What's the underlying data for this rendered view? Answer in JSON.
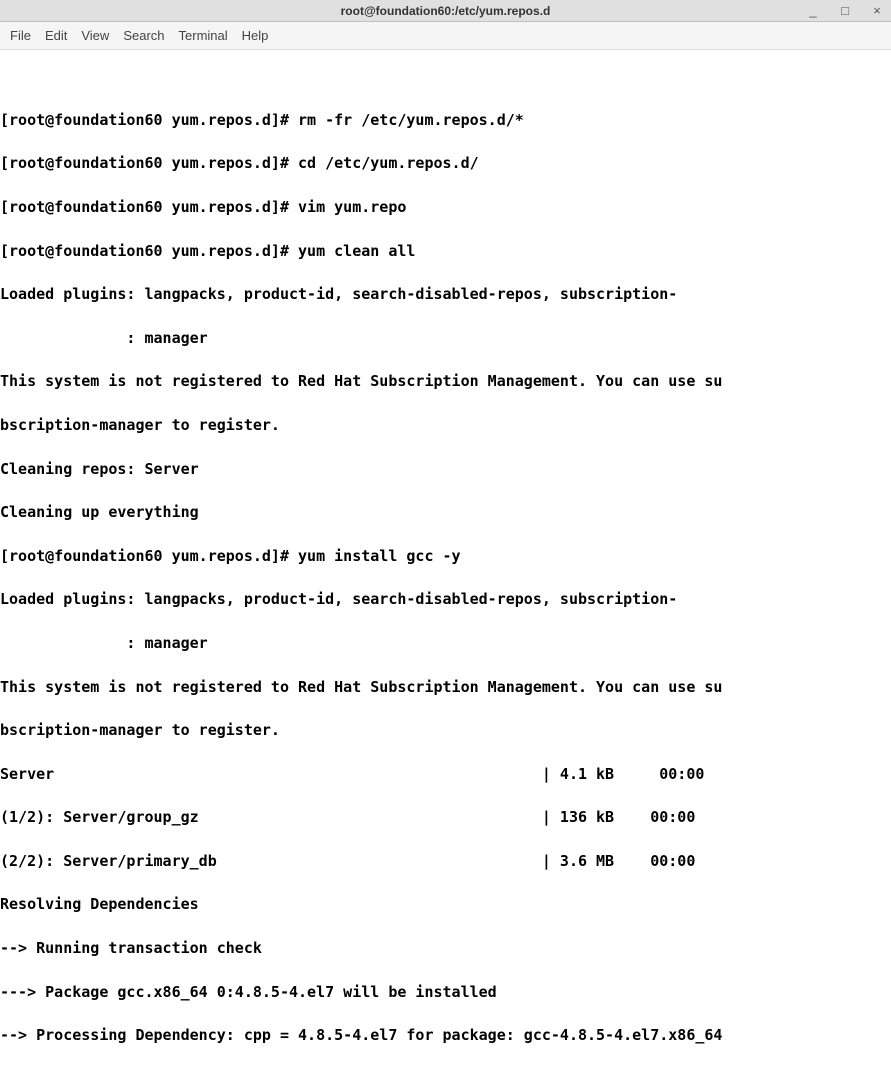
{
  "window": {
    "title": "root@foundation60:/etc/yum.repos.d"
  },
  "menubar": {
    "file": "File",
    "edit": "Edit",
    "view": "View",
    "search": "Search",
    "terminal": "Terminal",
    "help": "Help"
  },
  "prompt": "[root@foundation60 yum.repos.d]# ",
  "commands": {
    "c1": "rm -fr /etc/yum.repos.d/*",
    "c2": "cd /etc/yum.repos.d/",
    "c3": "vim yum.repo",
    "c4": "yum clean all",
    "c5": "yum install gcc -y"
  },
  "lines": {
    "l1": "Loaded plugins: langpacks, product-id, search-disabled-repos, subscription-",
    "l2": "              : manager",
    "l3": "This system is not registered to Red Hat Subscription Management. You can use su",
    "l4": "bscription-manager to register.",
    "l5": "Cleaning repos: Server",
    "l6": "Cleaning up everything",
    "l7": "Loaded plugins: langpacks, product-id, search-disabled-repos, subscription-",
    "l8": "              : manager",
    "l9": "This system is not registered to Red Hat Subscription Management. You can use su",
    "l10": "bscription-manager to register.",
    "l11": "Server                                                      | 4.1 kB     00:00",
    "l12": "(1/2): Server/group_gz                                      | 136 kB    00:00",
    "l13": "(2/2): Server/primary_db                                    | 3.6 MB    00:00",
    "l14": "Resolving Dependencies",
    "l15": "--> Running transaction check",
    "l16": "---> Package gcc.x86_64 0:4.8.5-4.el7 will be installed",
    "l17": "--> Processing Dependency: cpp = 4.8.5-4.el7 for package: gcc-4.8.5-4.el7.x86_64"
  }
}
